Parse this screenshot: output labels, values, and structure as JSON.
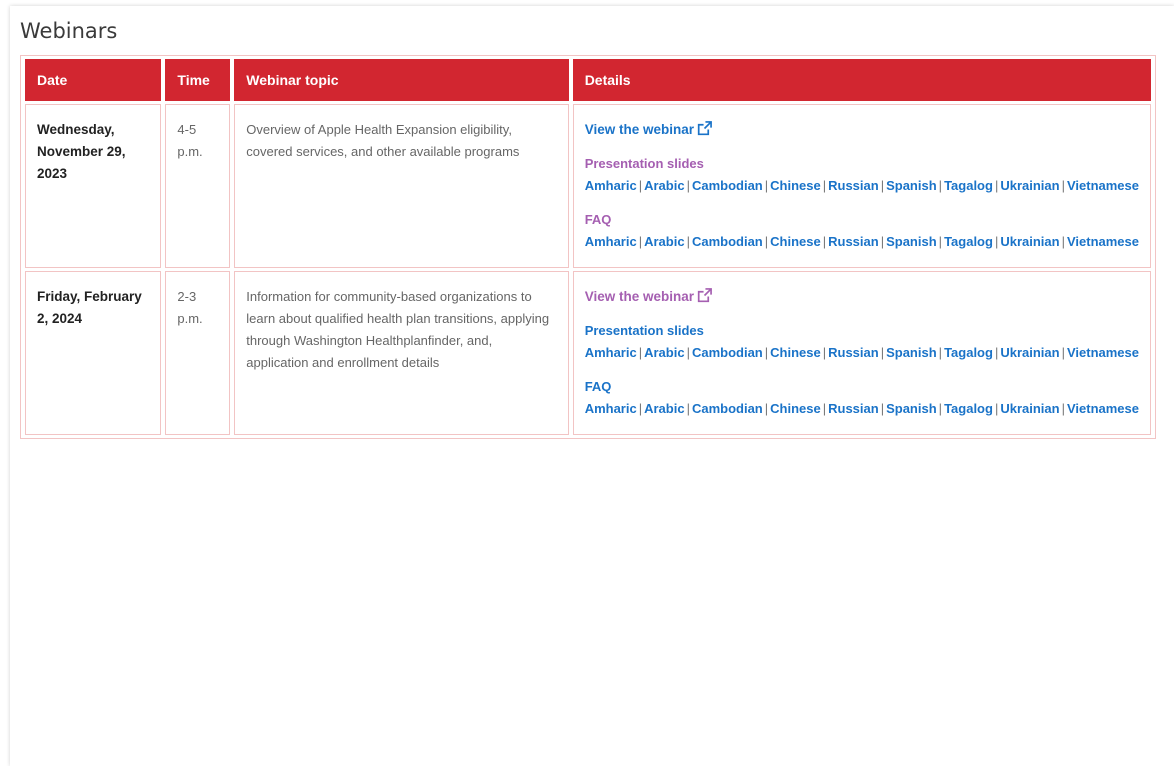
{
  "section_title": "Webinars",
  "table": {
    "headers": [
      "Date",
      "Time",
      "Webinar topic",
      "Details"
    ],
    "rows": [
      {
        "date": "Wednesday, November 29, 2023",
        "time": "4-5 p.m.",
        "topic": "Overview of Apple Health Expansion eligibility, covered services, and other available programs",
        "webinar_link": "View the webinar",
        "webinar_visited": false,
        "slides_label": "Presentation slides",
        "slides_visited": true,
        "slides_languages": [
          "Amharic",
          "Arabic",
          "Cambodian",
          "Chinese",
          "Russian",
          "Spanish",
          "Tagalog",
          "Ukrainian",
          "Vietnamese"
        ],
        "faq_label": "FAQ",
        "faq_visited": true,
        "faq_languages": [
          "Amharic",
          "Arabic",
          "Cambodian",
          "Chinese",
          "Russian",
          "Spanish",
          "Tagalog",
          "Ukrainian",
          "Vietnamese"
        ]
      },
      {
        "date": "Friday, February 2, 2024",
        "time": "2-3 p.m.",
        "topic": "Information for community-based organizations to learn about qualified health plan transitions, applying through Washington Healthplanfinder, and, application and enrollment details",
        "webinar_link": "View the webinar",
        "webinar_visited": true,
        "slides_label": "Presentation slides",
        "slides_visited": false,
        "slides_languages": [
          "Amharic",
          "Arabic",
          "Cambodian",
          "Chinese",
          "Russian",
          "Spanish",
          "Tagalog",
          "Ukrainian",
          "Vietnamese"
        ],
        "faq_label": "FAQ",
        "faq_visited": false,
        "faq_languages": [
          "Amharic",
          "Arabic",
          "Cambodian",
          "Chinese",
          "Russian",
          "Spanish",
          "Tagalog",
          "Ukrainian",
          "Vietnamese"
        ]
      }
    ]
  },
  "icons": {
    "external_link": "external-link-icon"
  },
  "colors": {
    "header_bg": "#d22630",
    "link": "#1a73c8",
    "visited_link": "#a55fb1",
    "border": "#f2c4c4"
  }
}
